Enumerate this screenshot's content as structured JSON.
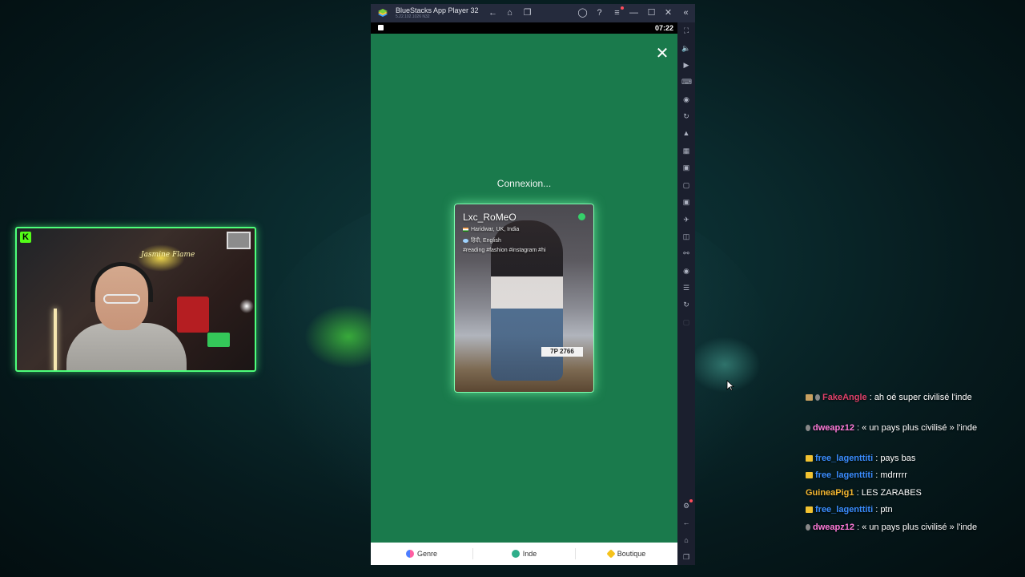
{
  "window": {
    "title": "BlueStacks App Player 32",
    "version": "5.22.102.1026 N32",
    "status_time": "07:22"
  },
  "app": {
    "status_text": "Connexion...",
    "profile": {
      "name": "Lxc_RoMeO",
      "location": "Haridwar, UK, India",
      "languages": "हिंदी, English",
      "tags": "#reading #fashion #instagram #hi",
      "plate": "7P 2766"
    },
    "bottom_nav": [
      {
        "label": "Genre",
        "icon": "gender-icon"
      },
      {
        "label": "Inde",
        "icon": "globe-icon"
      },
      {
        "label": "Boutique",
        "icon": "diamond-icon"
      }
    ]
  },
  "webcam": {
    "platform_logo": "K",
    "neon_sign": "Jasmine Flame"
  },
  "chat": [
    {
      "user": "FakeAngle",
      "user_color": "#e0416a",
      "message": "ah oé super civilisé l'inde",
      "badge": "box"
    },
    {
      "user": "dweapz12",
      "user_color": "#ff7ad9",
      "message": "« un pays plus civilisé » l'inde",
      "badge": "gem"
    },
    {
      "user": "free_lagenttiti",
      "user_color": "#3a8dff",
      "message": "pays bas",
      "badge": "crown"
    },
    {
      "user": "free_lagenttiti",
      "user_color": "#3a8dff",
      "message": "mdrrrrr",
      "badge": "crown"
    },
    {
      "user": "GuineaPig1",
      "user_color": "#f2b530",
      "message": "LES ZARABES",
      "badge": ""
    },
    {
      "user": "free_lagenttiti",
      "user_color": "#3a8dff",
      "message": "ptn",
      "badge": "crown"
    },
    {
      "user": "dweapz12",
      "user_color": "#ff7ad9",
      "message": "« un pays plus civilisé » l'inde",
      "badge": "gem"
    }
  ],
  "colors": {
    "app_background": "#1a7a4c",
    "webcam_border": "#4dff7a",
    "online": "#35d06a"
  }
}
